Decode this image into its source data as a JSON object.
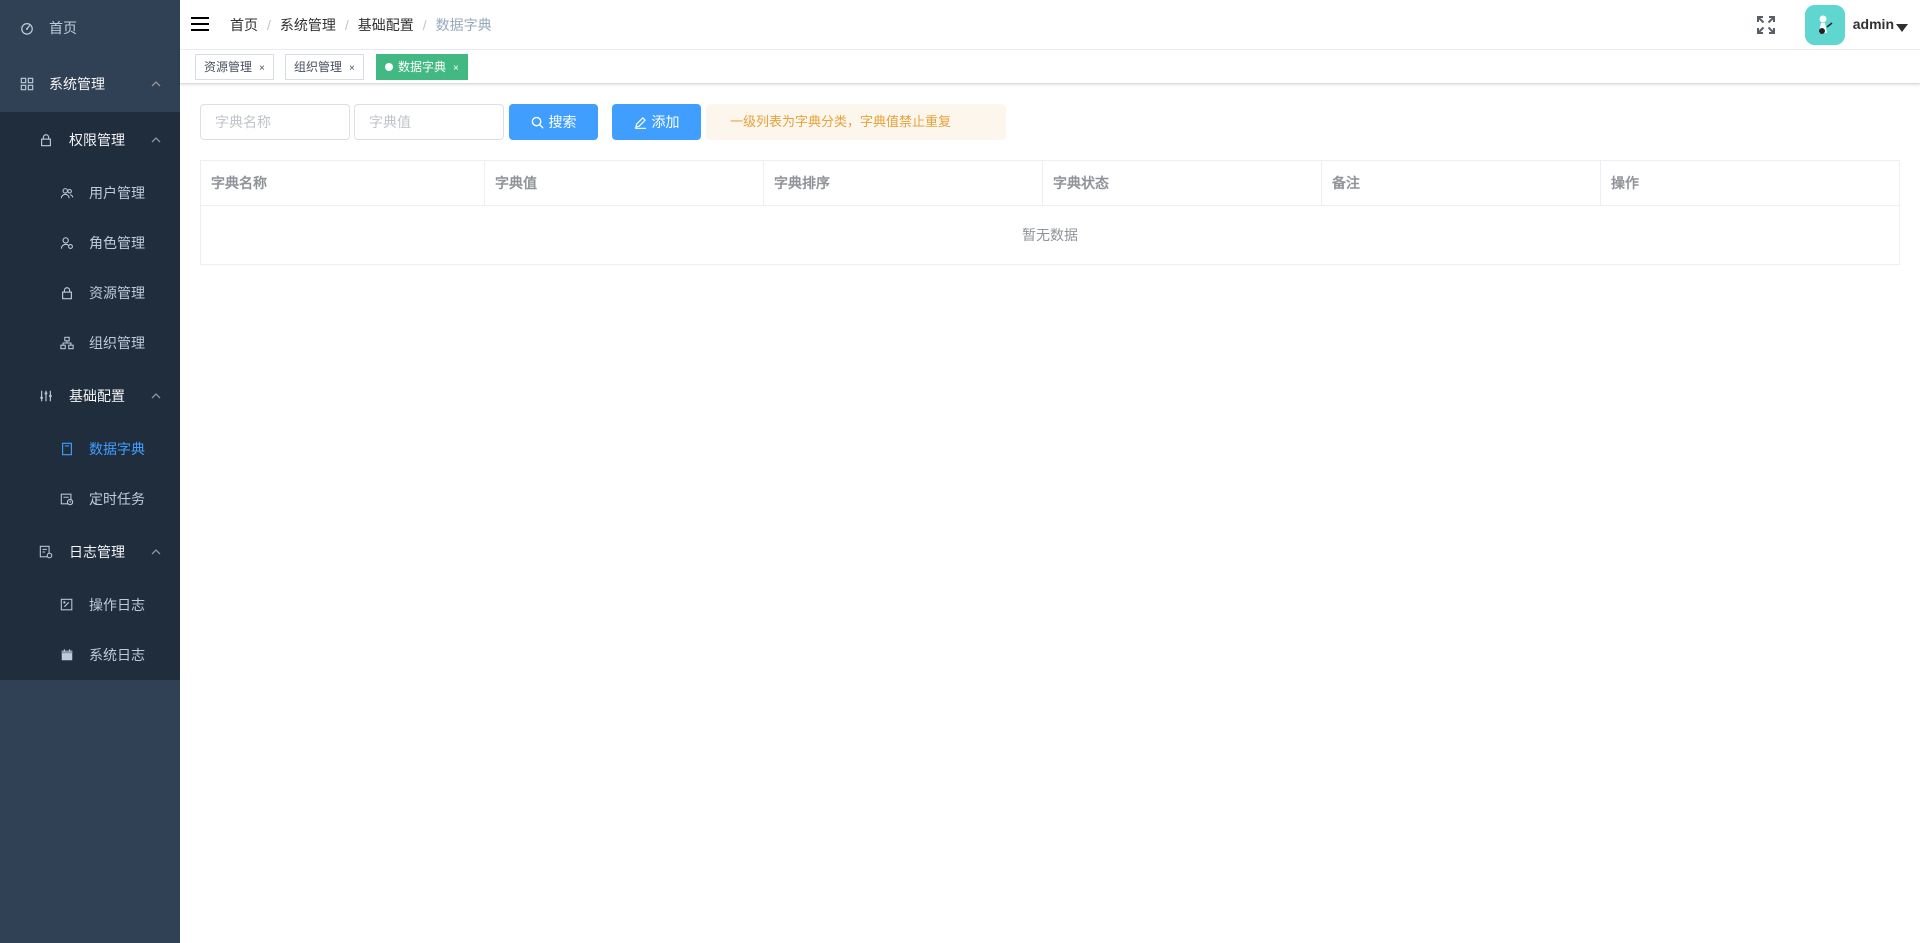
{
  "sidebar": {
    "home": "首页",
    "system": "系统管理",
    "permission": "权限管理",
    "users": "用户管理",
    "roles": "角色管理",
    "resources": "资源管理",
    "orgs": "组织管理",
    "basic_config": "基础配置",
    "dictionary": "数据字典",
    "scheduled_tasks": "定时任务",
    "logs": "日志管理",
    "operation_log": "操作日志",
    "system_log": "系统日志"
  },
  "header": {
    "breadcrumb": [
      "首页",
      "系统管理",
      "基础配置",
      "数据字典"
    ],
    "separator": "/",
    "username": "admin"
  },
  "tags": [
    {
      "label": "资源管理",
      "close": "×"
    },
    {
      "label": "组织管理",
      "close": "×"
    },
    {
      "label": "数据字典",
      "close": "×"
    }
  ],
  "toolbar": {
    "name_placeholder": "字典名称",
    "value_placeholder": "字典值",
    "search_label": "搜索",
    "add_label": "添加",
    "notice": "一级列表为字典分类，字典值禁止重复"
  },
  "table": {
    "columns": [
      "字典名称",
      "字典值",
      "字典排序",
      "字典状态",
      "备注",
      "操作"
    ],
    "empty_text": "暂无数据"
  },
  "colors": {
    "sidebar_bg": "#304156",
    "submenu_bg": "#1f2d3d",
    "active_menu": "#409eff",
    "active_tag": "#42b983",
    "primary_button": "#409eff",
    "notice_text": "#e6a23c"
  }
}
